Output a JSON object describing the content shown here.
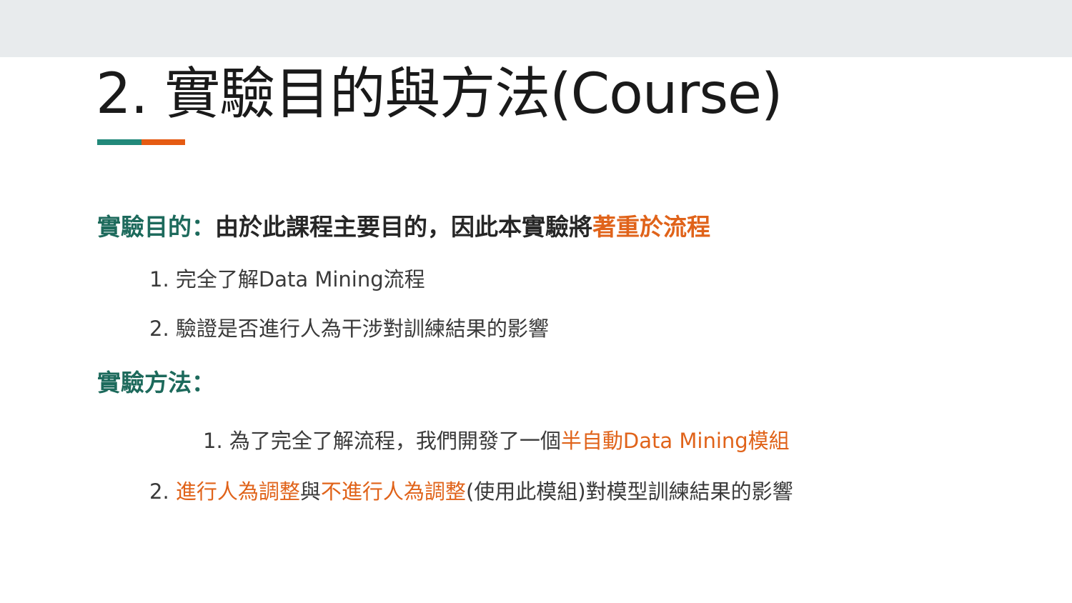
{
  "colors": {
    "accent_teal": "#22897a",
    "accent_orange": "#e55b13",
    "heading_teal": "#1d6a5c",
    "highlight_orange": "#e0631a",
    "top_bar": "#e8ebed"
  },
  "slide": {
    "title": "2. 實驗目的與方法(Course)",
    "purpose": {
      "label": "實驗目的：",
      "text": "由於此課程主要目的，因此本實驗將",
      "highlight": "著重於流程",
      "items": [
        {
          "prefix": "1. ",
          "text": "完全了解Data Mining流程"
        },
        {
          "prefix": "2. ",
          "text": "驗證是否進行人為干涉對訓練結果的影響"
        }
      ]
    },
    "method": {
      "label": "實驗方法：",
      "item1": {
        "prefix": "1. ",
        "text": "為了完全了解流程，我們開發了一個",
        "highlight": "半自動Data Mining模組"
      },
      "item2": {
        "prefix": "2. ",
        "highlight1": "進行人為調整",
        "mid": "與",
        "highlight2": "不進行人為調整",
        "rest": "(使用此模組)對模型訓練結果的影響"
      }
    }
  }
}
